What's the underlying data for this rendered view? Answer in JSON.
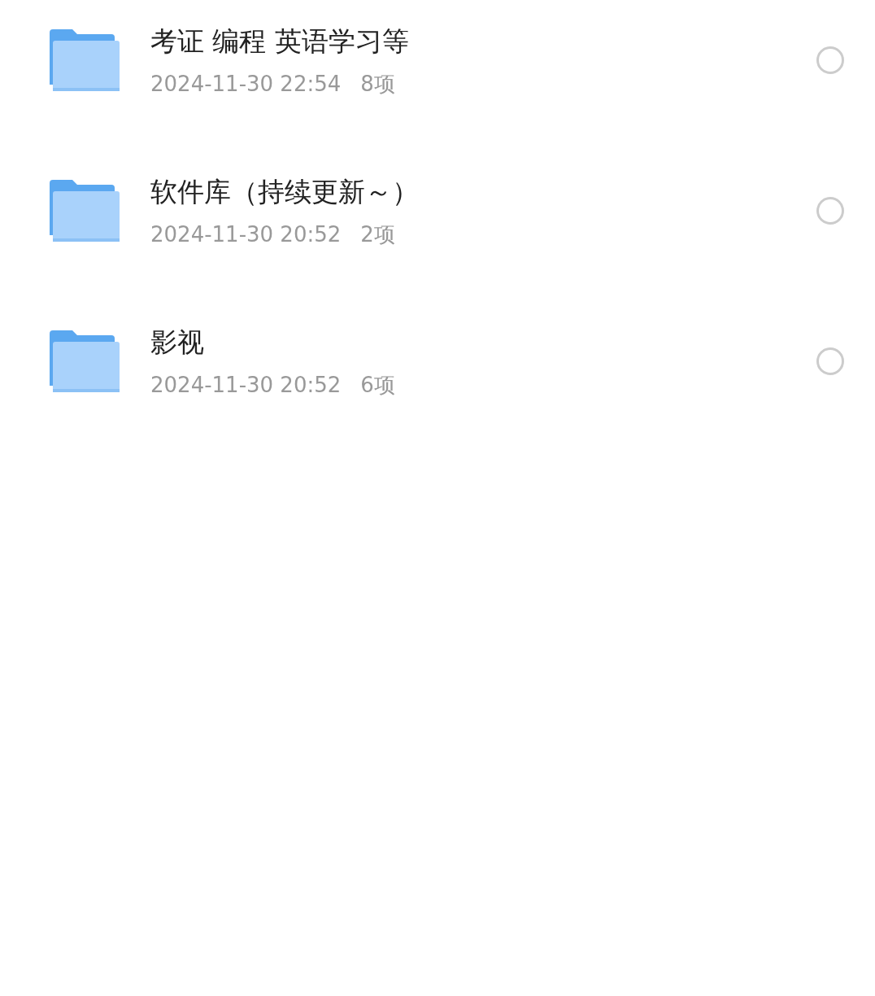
{
  "folders": [
    {
      "name": "考证 编程 英语学习等",
      "date": "2024-11-30 22:54",
      "count": "8项",
      "selected": false
    },
    {
      "name": "软件库（持续更新～）",
      "date": "2024-11-30 20:52",
      "count": "2项",
      "selected": false
    },
    {
      "name": "影视",
      "date": "2024-11-30 20:52",
      "count": "6项",
      "selected": false
    }
  ]
}
